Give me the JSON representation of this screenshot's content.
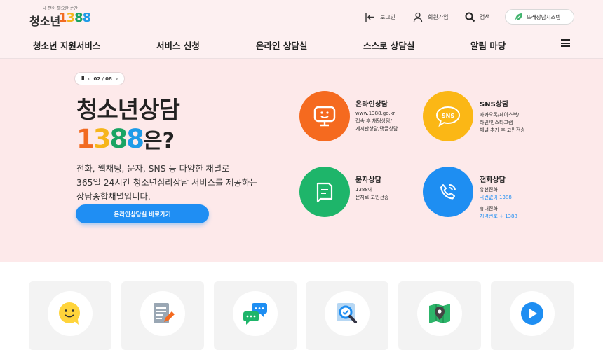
{
  "logo": {
    "tagline": "내 편이 필요한 순간",
    "name": "청소년",
    "num_1": "1",
    "num_3": "3",
    "num_8a": "8",
    "num_8b": "8"
  },
  "utility": {
    "login": "로그인",
    "signup": "회원가입",
    "search": "검색",
    "system": "또래상담시스템"
  },
  "nav": {
    "items": [
      "청소년 지원서비스",
      "서비스 신청",
      "온라인 상담실",
      "스스로 상담실",
      "알림 마당"
    ]
  },
  "hero": {
    "pager": {
      "pause": "II",
      "prev": "‹",
      "current": "02",
      "sep": "/",
      "total": "08",
      "next": "›"
    },
    "title": "청소년상담",
    "num_1": "1",
    "num_3": "3",
    "num_8a": "8",
    "num_8b": "8",
    "suffix": "은?",
    "desc": [
      "전화, 웹채팅, 문자, SNS 등 다양한 채널로",
      "365일 24시간 청소년심리상담 서비스를 제공하는",
      "상담종합채널입니다."
    ],
    "cta": "온라인상담실 바로가기"
  },
  "services": {
    "online": {
      "title": "온라인상담",
      "lines": [
        "www.1388.go.kr",
        "접속 후 채팅상담/",
        "게시판상담/댓글상담"
      ]
    },
    "sns": {
      "title": "SNS상담",
      "icon_text": "SNS",
      "lines": [
        "카카오톡/페이스북/",
        "라인/인스타그램",
        "채널 추가 후 고민전송"
      ]
    },
    "text": {
      "title": "문자상담",
      "lines": [
        "1388에",
        "문자로 고민전송"
      ]
    },
    "phone": {
      "title": "전화상담",
      "lines": [
        "유선전화",
        "국번없이 1388",
        "휴대전화",
        "지역번호 + 1388"
      ]
    }
  },
  "colors": {
    "online": "#f56a1f",
    "sns": "#fbb715",
    "text": "#1eb56a",
    "phone": "#1e8ef2",
    "hero_bg": "#fde9ea",
    "accent_blue": "#1f8ef3"
  },
  "cards": [
    {
      "icon": "smile-face-icon"
    },
    {
      "icon": "document-pencil-icon"
    },
    {
      "icon": "chat-bubbles-icon"
    },
    {
      "icon": "search-check-icon"
    },
    {
      "icon": "map-pin-icon"
    },
    {
      "icon": "play-icon"
    }
  ]
}
